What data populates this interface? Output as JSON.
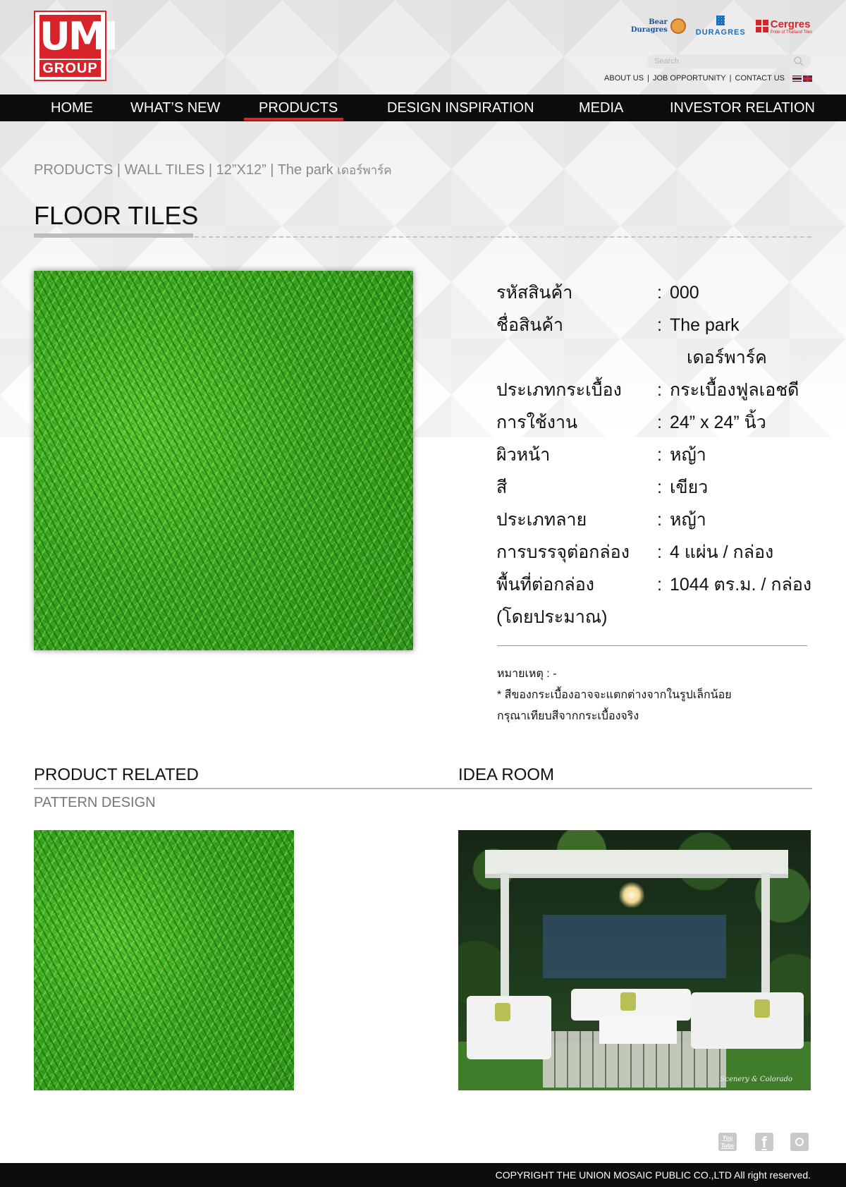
{
  "header": {
    "logo": {
      "mark": "UMI",
      "group": "GROUP"
    },
    "brands": [
      {
        "name": "Bear Duragres",
        "line1": "Bear",
        "line2": "Duragres"
      },
      {
        "name": "DURAGRES"
      },
      {
        "name": "Cergres",
        "sub": "Pride of Thailand Tiles"
      }
    ],
    "search": {
      "placeholder": "Search"
    },
    "top_links": [
      "ABOUT US",
      "JOB OPPORTUNITY",
      "CONTACT US"
    ],
    "separator": "|"
  },
  "nav": {
    "items": [
      "HOME",
      "WHAT’S NEW",
      "PRODUCTS",
      "DESIGN INSPIRATION",
      "MEDIA",
      "INVESTOR RELATION"
    ],
    "active": "PRODUCTS",
    "active_color": "#d8232a"
  },
  "breadcrumb": {
    "text": "PRODUCTS | WALL TILES | 12”X12” | The park",
    "thai": "เดอร์พาร์ค"
  },
  "page_title": "FLOOR TILES",
  "specs": [
    {
      "label": "รหัสสินค้า",
      "value": "000"
    },
    {
      "label": "ชื่อสินค้า",
      "value": "The  park",
      "value2": "เดอร์พาร์ค"
    },
    {
      "label": "ประเภทกระเบื้อง",
      "value": "กระเบื้องฟูลเอชดี"
    },
    {
      "label": "การใช้งาน",
      "value": "24”  x  24”  นิ้ว"
    },
    {
      "label": "ผิวหน้า",
      "value": "หญ้า"
    },
    {
      "label": "สี",
      "value": "เขียว"
    },
    {
      "label": "ประเภทลาย",
      "value": "หญ้า"
    },
    {
      "label": "การบรรจุต่อกล่อง",
      "value": "4  แผ่น  /  กล่อง"
    },
    {
      "label": "พื้นที่ต่อกล่อง",
      "value": "1044  ตร.ม.  /  กล่อง",
      "label2": "(โดยประมาณ)"
    }
  ],
  "colon": ":",
  "note": {
    "line1": "หมายเหตุ : -",
    "line2": "*  สีของกระเบื้องอาจจะแตกต่างจากในรูปเล็กน้อย",
    "line3": "กรุณาเทียบสีจากกระเบื้องจริง"
  },
  "sections": {
    "related": "PRODUCT RELATED",
    "idea": "IDEA ROOM",
    "pattern": "PATTERN DESIGN"
  },
  "room_caption": "Scenery & Colorado",
  "social": [
    "youtube-icon",
    "facebook-icon",
    "instagram-icon"
  ],
  "social_labels": {
    "yt": "You Tube",
    "fb": "f"
  },
  "footer": "COPYRIGHT THE UNION MOSAIC PUBLIC CO.,LTD All right reserved."
}
